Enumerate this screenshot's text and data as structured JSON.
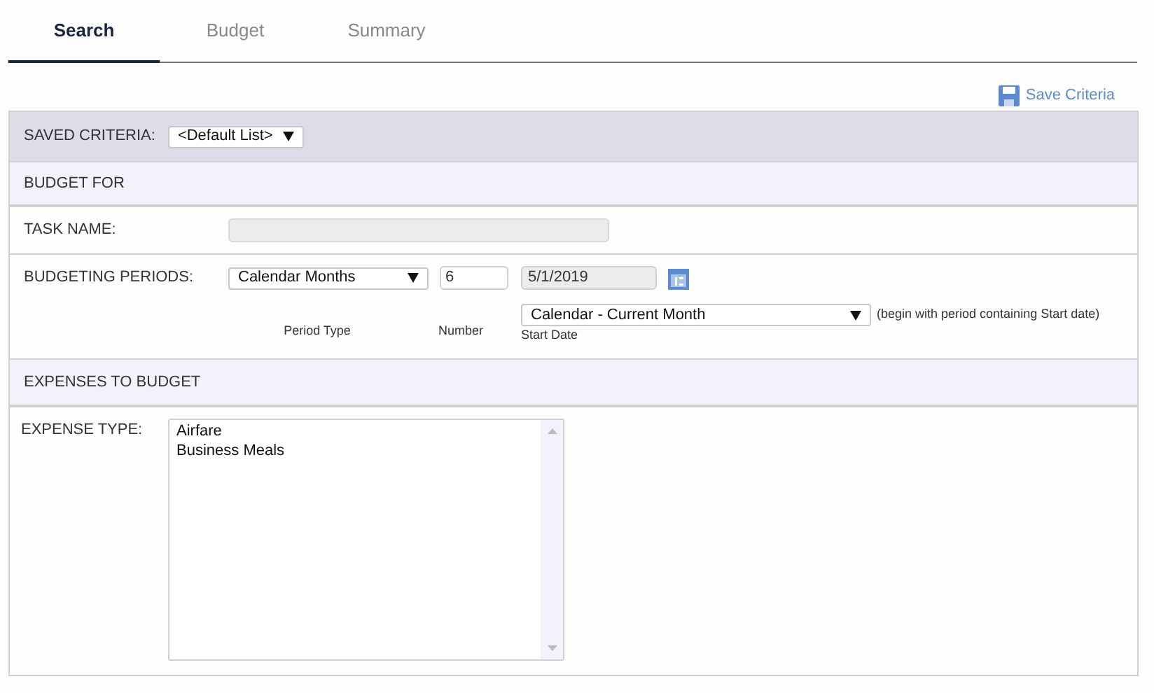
{
  "tabs": [
    {
      "label": "Search",
      "selected": true
    },
    {
      "label": "Budget",
      "selected": false
    },
    {
      "label": "Summary",
      "selected": false
    }
  ],
  "save_link": "Save Criteria",
  "saved_criteria": {
    "label": "SAVED CRITERIA:",
    "value": "<Default List>"
  },
  "budget_for": {
    "heading": "BUDGET FOR",
    "task_name": {
      "label": "TASK NAME:",
      "disabled": true
    },
    "budgeting_periods": {
      "label": "BUDGETING PERIODS:",
      "period_type": {
        "value": "Calendar Months",
        "caption": "Period Type"
      },
      "number": {
        "value": "6",
        "caption": "Number"
      },
      "start_date": {
        "value": "5/1/2019",
        "caption": "Start Date",
        "disabled": true
      },
      "start_mode": {
        "value": "Calendar - Current Month",
        "note": "(begin with period containing Start date)"
      }
    }
  },
  "expenses": {
    "heading": "EXPENSES TO BUDGET",
    "label": "EXPENSE TYPE:",
    "items": [
      {
        "label": "Airfare",
        "selected": false
      },
      {
        "label": "Business Meals",
        "selected": false
      }
    ]
  }
}
